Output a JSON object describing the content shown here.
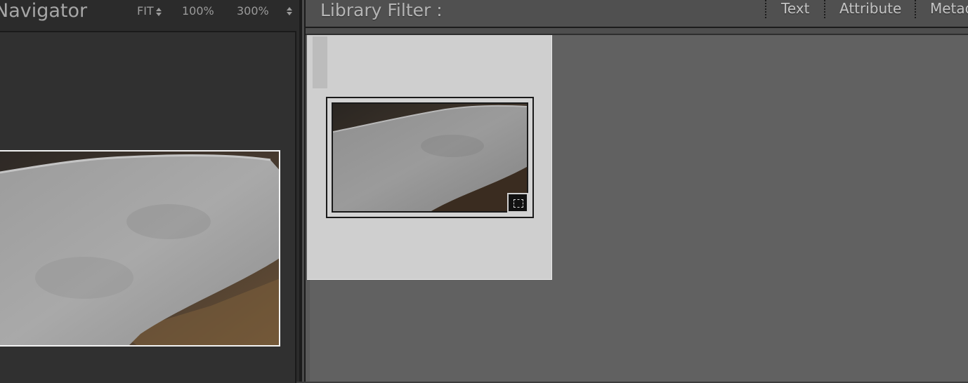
{
  "navigator": {
    "title": "Navigator",
    "zoom_options": [
      "FIT",
      "100%",
      "300%"
    ]
  },
  "library_filter": {
    "title": "Library Filter :",
    "tabs": [
      "Text",
      "Attribute",
      "Metadata"
    ]
  },
  "colors": {
    "panel_bg": "#2b2b2b",
    "grid_bg": "#616161",
    "cell_bg": "#cfcfcf",
    "text_primary": "#c4c4c4"
  },
  "icons": {
    "zoom_stepper": "updown-icon",
    "thumbnail_badge": "crop-icon"
  }
}
